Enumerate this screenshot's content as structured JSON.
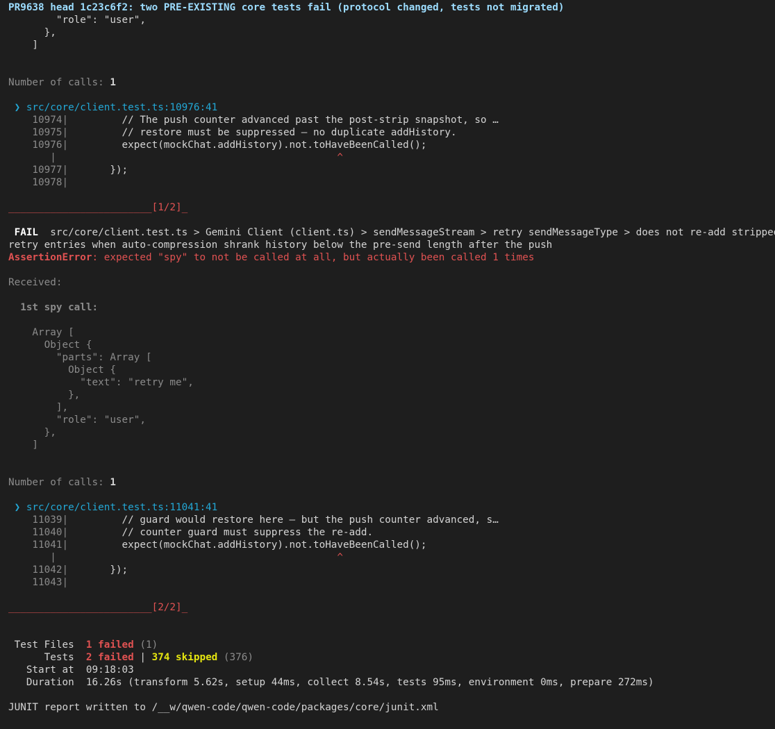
{
  "header": {
    "title": "PR9638 head 1c23c6f2: two PRE-EXISTING core tests fail (protocol changed, tests not migrated)"
  },
  "top_tail": [
    "        \"role\": \"user\",",
    "      },",
    "    ]"
  ],
  "calls1": {
    "label": "Number of calls: ",
    "value": "1"
  },
  "frame1": {
    "arrow": " ❯ ",
    "location": "src/core/client.test.ts:10976:41",
    "lines": [
      {
        "num": "    10974|",
        "code": "         // The push counter advanced past the post-strip snapshot, so …"
      },
      {
        "num": "    10975|",
        "code": "         // restore must be suppressed — no duplicate addHistory."
      },
      {
        "num": "    10976|",
        "code": "         expect(mockChat.addHistory).not.toHaveBeenCalled();"
      }
    ],
    "caret_pipe": "       |",
    "caret": "                                               ^",
    "after": [
      {
        "num": "    10977|",
        "code": "       });"
      },
      {
        "num": "    10978|",
        "code": ""
      }
    ]
  },
  "sep1": {
    "bar": "________________________",
    "mark": "[1/2]",
    "tail": "_"
  },
  "fail_block": {
    "fail_tag": " FAIL ",
    "path_line1": " src/core/client.test.ts > Gemini Client (client.ts) > sendMessageStream > retry sendMessageType > does not re-add stripped",
    "path_line2": "retry entries when auto-compression shrank history below the pre-send length after the push",
    "error_name": "AssertionError",
    "error_msg": ": expected \"spy\" to not be called at all, but actually been called 1 times"
  },
  "received": {
    "label": "Received:",
    "spy_call": "  1st spy call:",
    "array_lines": [
      "    Array [",
      "      Object {",
      "        \"parts\": Array [",
      "          Object {",
      "            \"text\": \"retry me\",",
      "          },",
      "        ],",
      "        \"role\": \"user\",",
      "      },",
      "    ]"
    ]
  },
  "calls2": {
    "label": "Number of calls: ",
    "value": "1"
  },
  "frame2": {
    "arrow": " ❯ ",
    "location": "src/core/client.test.ts:11041:41",
    "lines": [
      {
        "num": "    11039|",
        "code": "         // guard would restore here — but the push counter advanced, s…"
      },
      {
        "num": "    11040|",
        "code": "         // counter guard must suppress the re-add."
      },
      {
        "num": "    11041|",
        "code": "         expect(mockChat.addHistory).not.toHaveBeenCalled();"
      }
    ],
    "caret_pipe": "       |",
    "caret": "                                               ^",
    "after": [
      {
        "num": "    11042|",
        "code": "       });"
      },
      {
        "num": "    11043|",
        "code": ""
      }
    ]
  },
  "sep2": {
    "bar": "________________________",
    "mark": "[2/2]",
    "tail": "_"
  },
  "summary": {
    "test_files_label": " Test Files  ",
    "test_files_failed": "1 failed",
    "test_files_total": " (1)",
    "tests_label": "      Tests  ",
    "tests_failed": "2 failed",
    "tests_sep": " | ",
    "tests_skipped": "374 skipped",
    "tests_total": " (376)",
    "start_label": "   Start at  ",
    "start_value": "09:18:03",
    "duration_label": "   Duration  ",
    "duration_value": "16.26s (transform 5.62s, setup 44ms, collect 8.54s, tests 95ms, environment 0ms, prepare 272ms)"
  },
  "junit": "JUNIT report written to /__w/qwen-code/qwen-code/packages/core/junit.xml",
  "colors": {
    "background": "#1e1e1e",
    "title": "#9cdcfe",
    "link": "#23a8d6",
    "error": "#e05252",
    "skipped": "#e5e510",
    "dim": "#8b8b8b"
  }
}
